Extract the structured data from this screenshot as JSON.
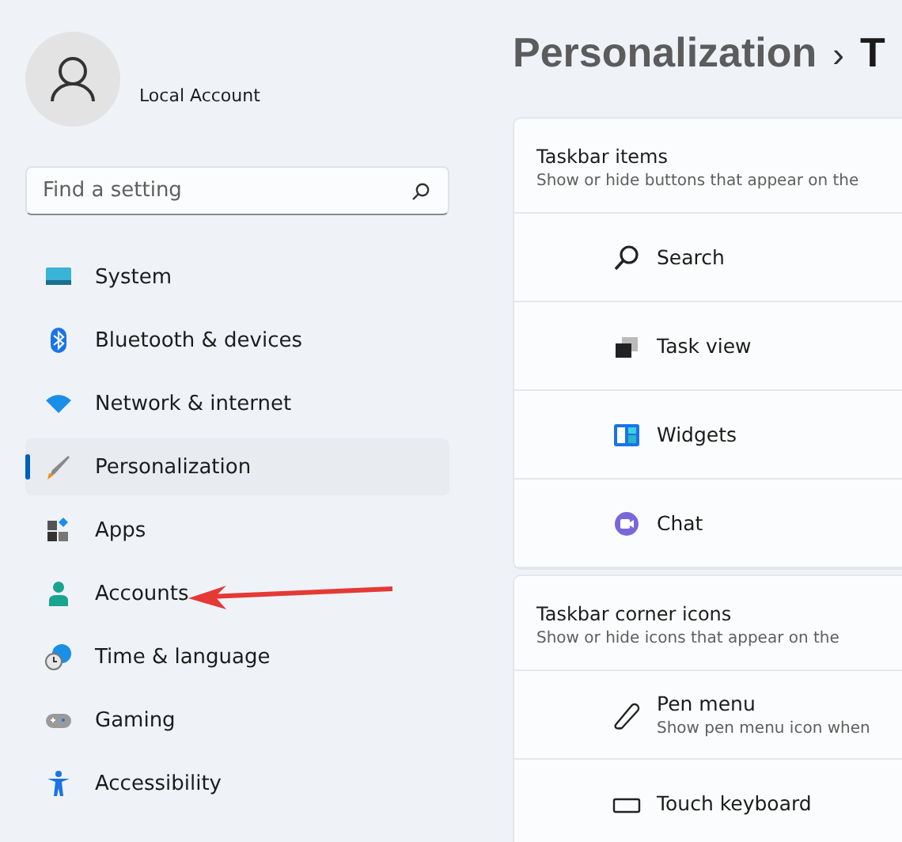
{
  "account": {
    "name": "Local Account"
  },
  "search": {
    "placeholder": "Find a setting"
  },
  "sidebar": {
    "items": [
      {
        "label": "System",
        "selected": false
      },
      {
        "label": "Bluetooth & devices",
        "selected": false
      },
      {
        "label": "Network & internet",
        "selected": false
      },
      {
        "label": "Personalization",
        "selected": true
      },
      {
        "label": "Apps",
        "selected": false
      },
      {
        "label": "Accounts",
        "selected": false
      },
      {
        "label": "Time & language",
        "selected": false
      },
      {
        "label": "Gaming",
        "selected": false
      },
      {
        "label": "Accessibility",
        "selected": false
      }
    ]
  },
  "breadcrumb": {
    "parent": "Personalization",
    "separator": "›",
    "current": "T"
  },
  "sections": [
    {
      "title": "Taskbar items",
      "subtitle": "Show or hide buttons that appear on the",
      "rows": [
        {
          "label": "Search"
        },
        {
          "label": "Task view"
        },
        {
          "label": "Widgets"
        },
        {
          "label": "Chat"
        }
      ]
    },
    {
      "title": "Taskbar corner icons",
      "subtitle": "Show or hide icons that appear on the",
      "rows": [
        {
          "label": "Pen menu",
          "description": "Show pen menu icon when"
        },
        {
          "label": "Touch keyboard"
        }
      ]
    }
  ]
}
